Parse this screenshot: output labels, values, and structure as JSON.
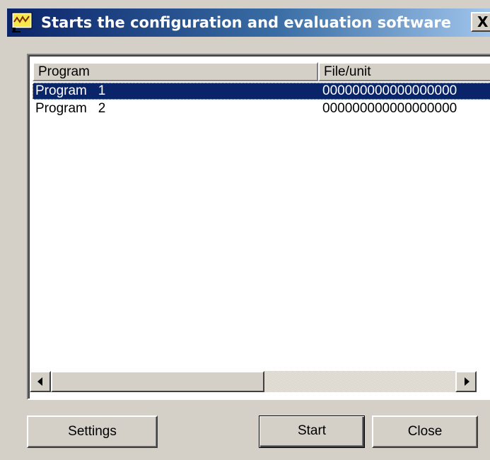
{
  "window": {
    "title": "Starts the configuration and evaluation software",
    "icon": "app-icon",
    "close_label": "X"
  },
  "list": {
    "columns": [
      "Program",
      "File/unit"
    ],
    "rows": [
      {
        "program": "Program   1",
        "file_unit": "000000000000000000",
        "selected": true
      },
      {
        "program": "Program   2",
        "file_unit": "000000000000000000",
        "selected": false
      }
    ]
  },
  "scrollbar": {
    "left_icon": "arrow-left-icon",
    "right_icon": "arrow-right-icon"
  },
  "buttons": {
    "settings": "Settings",
    "start": "Start",
    "close": "Close"
  },
  "colors": {
    "titlebar_start": "#0a246a",
    "titlebar_end": "#a6caf0",
    "selection": "#0a246a",
    "face": "#d4d0c8"
  }
}
